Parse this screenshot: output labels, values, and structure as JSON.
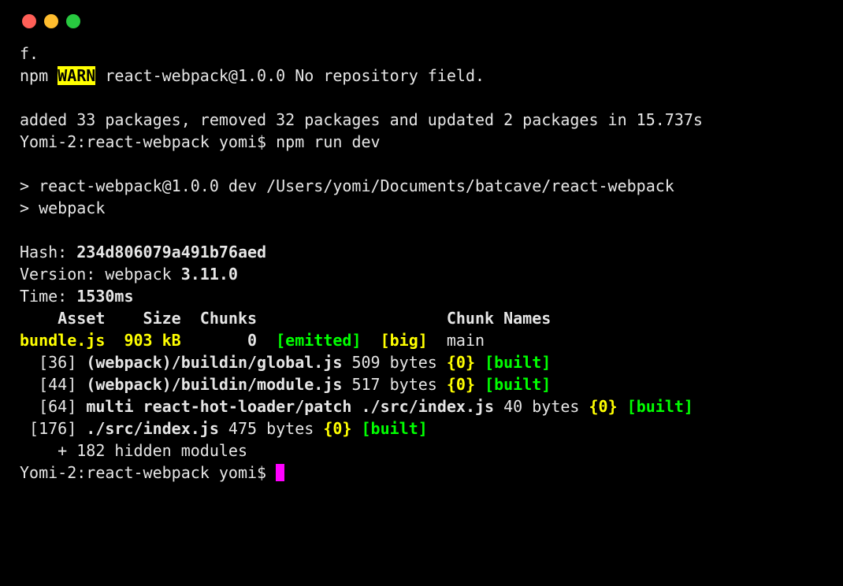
{
  "colors": {
    "close": "#ff5f57",
    "minimize": "#ffbd2e",
    "maximize": "#28c940",
    "yellow": "#ffff00",
    "green": "#00ff00",
    "cursor": "#ff00ff"
  },
  "lines": {
    "l1": "f.",
    "npm_prefix": "npm ",
    "warn_badge": "WARN",
    "warn_rest": " react-webpack@1.0.0 No repository field.",
    "summary": "added 33 packages, removed 32 packages and updated 2 packages in 15.737s",
    "prompt1_host": "Yomi-2:",
    "prompt1_dir": "react-webpack ",
    "prompt1_user": "yomi$ ",
    "prompt1_cmd": "npm run dev",
    "script_line1": "> react-webpack@1.0.0 dev /Users/yomi/Documents/batcave/react-webpack",
    "script_line2": "> webpack",
    "hash_label": "Hash: ",
    "hash_value": "234d806079a491b76aed",
    "version_label": "Version: ",
    "version_prefix": "webpack ",
    "version_value": "3.11.0",
    "time_label": "Time: ",
    "time_value": "1530ms",
    "table_header": "    Asset    Size  Chunks                    Chunk Names",
    "row_asset": "bundle.js  903 kB",
    "row_chunk": "       0  ",
    "row_emitted": "[emitted]  ",
    "row_big": "[big]  ",
    "row_chunkname": "main",
    "mod36_pre": "  [36] ",
    "mod36_name": "(webpack)/buildin/global.js",
    "mod36_size": " 509 bytes ",
    "mod36_chunk": "{0}",
    "mod36_space": " ",
    "mod36_built": "[built]",
    "mod44_pre": "  [44] ",
    "mod44_name": "(webpack)/buildin/module.js",
    "mod44_size": " 517 bytes ",
    "mod44_chunk": "{0}",
    "mod44_space": " ",
    "mod44_built": "[built]",
    "mod64_pre": "  [64] ",
    "mod64_name": "multi react-hot-loader/patch ./src/index.js",
    "mod64_size": " 40 bytes ",
    "mod64_chunk": "{0}",
    "mod64_space": " ",
    "mod64_built": "[built]",
    "mod176_pre": " [176] ",
    "mod176_name": "./src/index.js",
    "mod176_size": " 475 bytes ",
    "mod176_chunk": "{0}",
    "mod176_space": " ",
    "mod176_built": "[built]",
    "hidden": "    + 182 hidden modules",
    "prompt2_host": "Yomi-2:",
    "prompt2_dir": "react-webpack ",
    "prompt2_user": "yomi$ "
  }
}
